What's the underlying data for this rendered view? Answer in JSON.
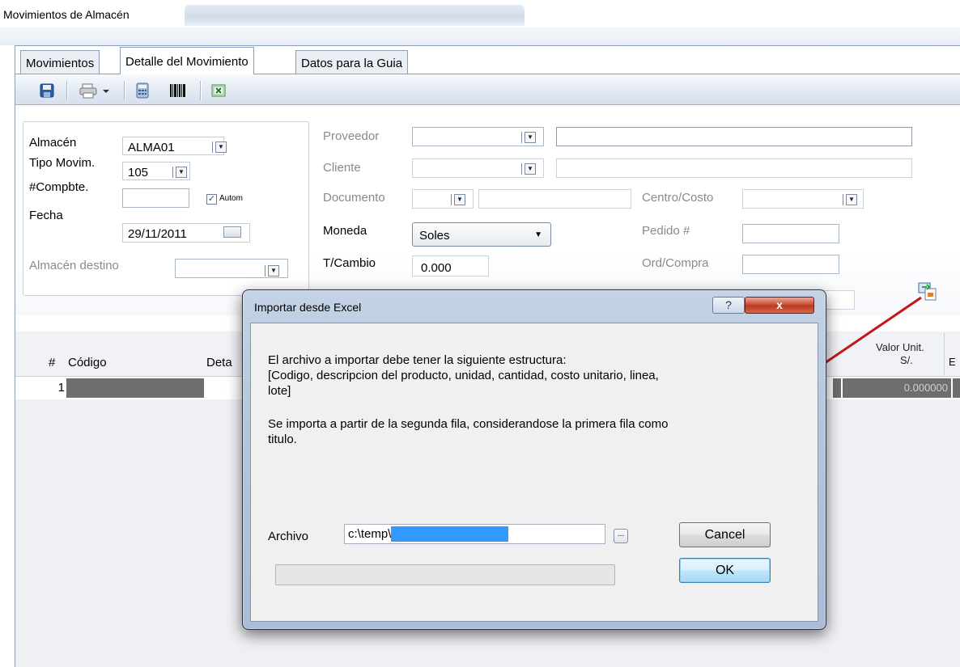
{
  "window": {
    "title": "Movimientos de Almacén"
  },
  "tabs": [
    {
      "label": "Movimientos",
      "active": false
    },
    {
      "label": "Detalle del Movimiento",
      "active": true
    },
    {
      "label": "Datos para la Guia",
      "active": false
    }
  ],
  "toolbar": {
    "icons": [
      "save-icon",
      "print-icon",
      "calculator-icon",
      "barcode-icon",
      "excel-icon"
    ]
  },
  "form": {
    "almacen_label": "Almacén",
    "almacen_value": "ALMA01",
    "tipo_movim_label": "Tipo Movim.",
    "tipo_movim_value": "105",
    "compbte_label": "#Compbte.",
    "compbte_value": "",
    "autom_label": "Autom",
    "autom_checked": true,
    "fecha_label": "Fecha",
    "fecha_value": "29/11/2011",
    "almacen_destino_label": "Almacén destino",
    "almacen_destino_value": "",
    "proveedor_label": "Proveedor",
    "cliente_label": "Cliente",
    "documento_label": "Documento",
    "centro_costo_label": "Centro/Costo",
    "moneda_label": "Moneda",
    "moneda_value": "Soles",
    "pedido_label": "Pedido #",
    "tcambio_label": "T/Cambio",
    "tcambio_value": "0.000",
    "ordcompra_label": "Ord/Compra"
  },
  "grid": {
    "columns": [
      "#",
      "Código",
      "Deta",
      "Valor Unit.",
      "S/."
    ],
    "rows": [
      {
        "num": "1",
        "valor_unit": "0.000000"
      }
    ]
  },
  "dialog": {
    "title": "Importar desde Excel",
    "help_label": "?",
    "close_label": "x",
    "line1": "El archivo a importar debe tener la siguiente estructura:",
    "line2": "[Codigo, descripcion del producto, unidad, cantidad, costo unitario, linea,",
    "line3": "lote]",
    "line4": "Se importa a partir de la segunda fila, considerandose la primera fila como",
    "line5": "titulo.",
    "archivo_label": "Archivo",
    "archivo_value": "c:\\temp\\",
    "browse_label": "...",
    "cancel_label": "Cancel",
    "ok_label": "OK",
    "progress": 0
  },
  "colors": {
    "accent": "#3399ff",
    "arrow": "#c01818",
    "close_red": "#c9482f"
  }
}
